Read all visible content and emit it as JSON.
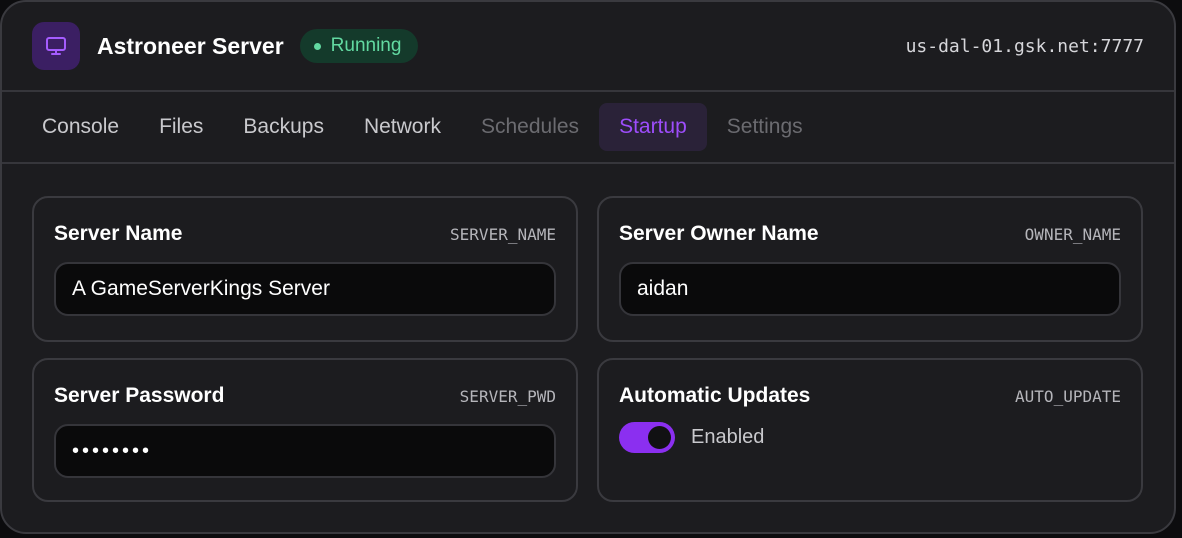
{
  "header": {
    "icon": "monitor-icon",
    "title": "Astroneer Server",
    "status": "Running",
    "status_color": "#62d9a1",
    "address": "us-dal-01.gsk.net:7777"
  },
  "tabs": [
    {
      "label": "Console",
      "state": "normal"
    },
    {
      "label": "Files",
      "state": "normal"
    },
    {
      "label": "Backups",
      "state": "normal"
    },
    {
      "label": "Network",
      "state": "normal"
    },
    {
      "label": "Schedules",
      "state": "disabled"
    },
    {
      "label": "Startup",
      "state": "active"
    },
    {
      "label": "Settings",
      "state": "disabled"
    }
  ],
  "accent_color": "#9d4dfb",
  "variables": {
    "server_name": {
      "label": "Server Name",
      "key": "SERVER_NAME",
      "value": "A GameServerKings Server"
    },
    "owner_name": {
      "label": "Server Owner Name",
      "key": "OWNER_NAME",
      "value": "aidan"
    },
    "password": {
      "label": "Server Password",
      "key": "SERVER_PWD",
      "value": "••••••••"
    },
    "auto_update": {
      "label": "Automatic Updates",
      "key": "AUTO_UPDATE",
      "toggle_state": "Enabled",
      "enabled": true
    }
  }
}
